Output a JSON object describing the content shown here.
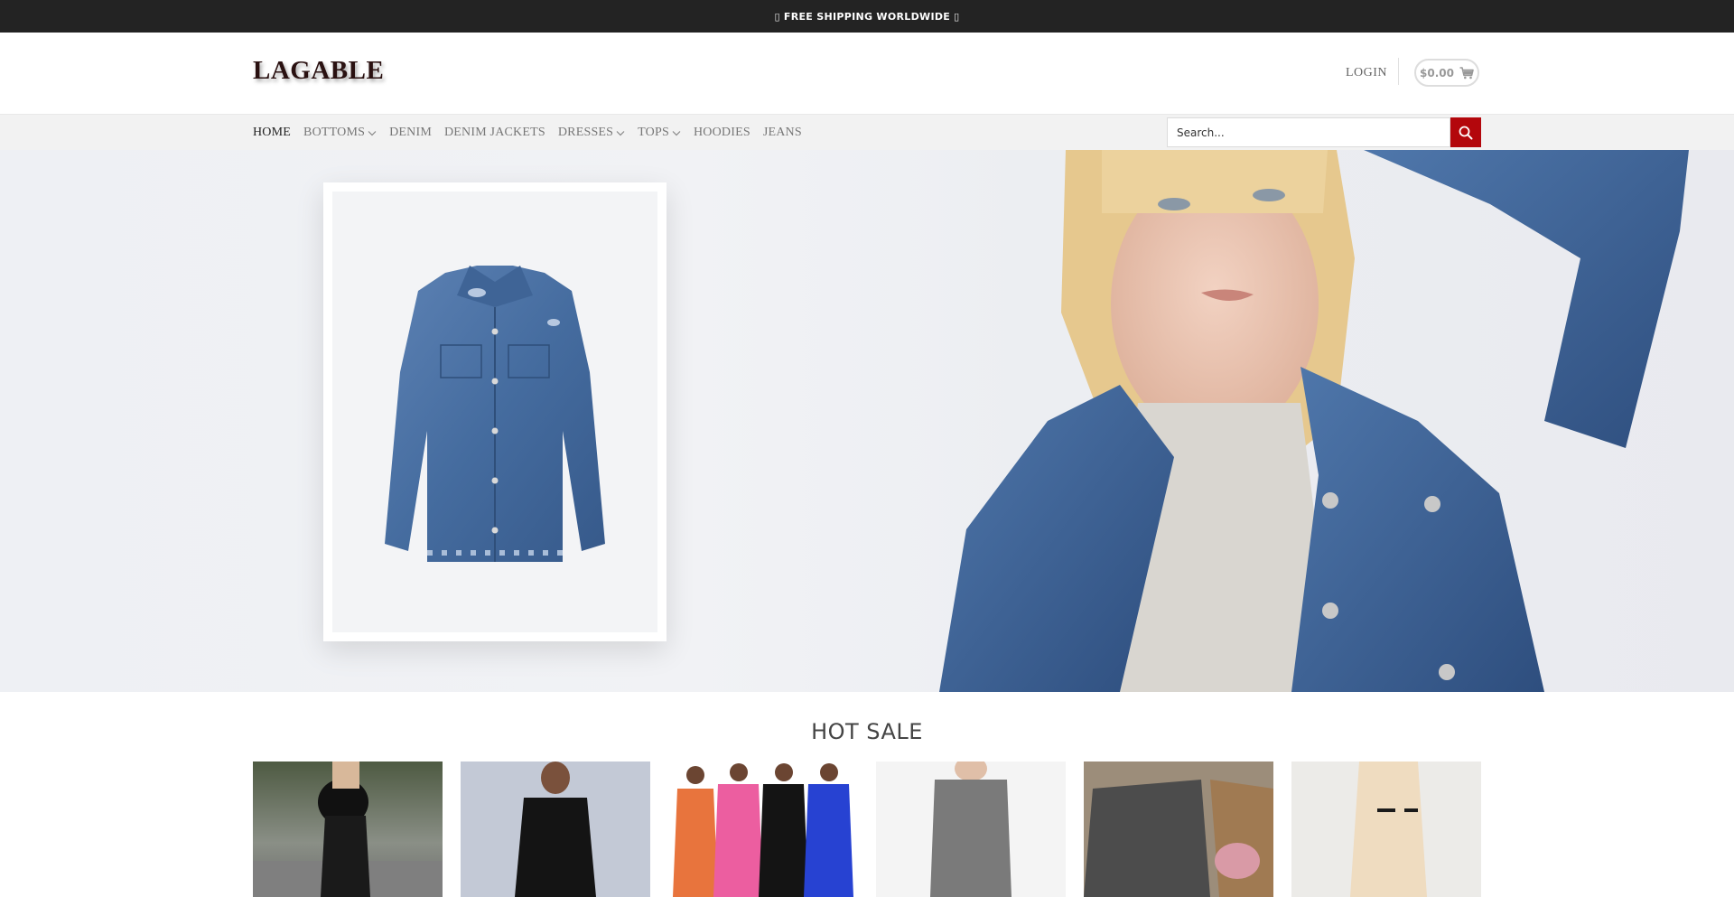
{
  "topbar": {
    "text": "FREE SHIPPING WORLDWIDE",
    "left_glyph": "▯",
    "right_glyph": "▯"
  },
  "header": {
    "logo": "LAGABLE",
    "login": "LOGIN",
    "cart_total": "$0.00"
  },
  "nav": {
    "items": [
      {
        "label": "HOME",
        "active": true,
        "dropdown": false
      },
      {
        "label": "BOTTOMS",
        "dropdown": true
      },
      {
        "label": "DENIM",
        "dropdown": false
      },
      {
        "label": "DENIM JACKETS",
        "dropdown": false
      },
      {
        "label": "DRESSES",
        "dropdown": true
      },
      {
        "label": "TOPS",
        "dropdown": true
      },
      {
        "label": "HOODIES",
        "dropdown": false
      },
      {
        "label": "JEANS",
        "dropdown": false
      }
    ]
  },
  "search": {
    "placeholder": "Search..."
  },
  "section": {
    "title": "HOT SALE"
  },
  "colors": {
    "accent": "#b3070c",
    "topbar": "#232323",
    "navbar": "#f2f2f2"
  }
}
